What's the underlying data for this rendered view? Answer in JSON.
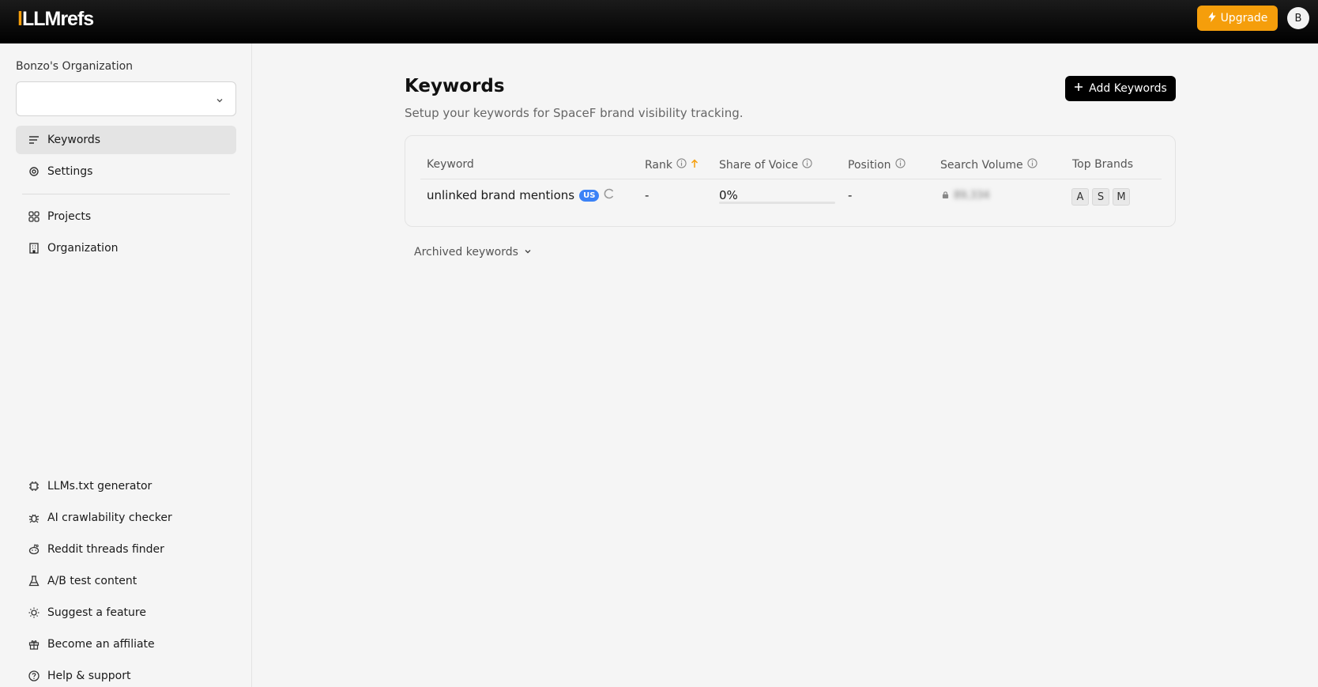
{
  "header": {
    "logo_prefix": "LLM",
    "logo_suffix": "refs",
    "upgrade_label": "Upgrade",
    "avatar_initial": "B",
    "brand_color": "#f59e0b"
  },
  "sidebar": {
    "org_name": "Bonzo's Organization",
    "project_select_value": "",
    "top_items": [
      {
        "label": "Keywords",
        "icon": "lines-icon",
        "active": true
      },
      {
        "label": "Settings",
        "icon": "gear-icon"
      }
    ],
    "mid_items": [
      {
        "label": "Projects",
        "icon": "grid-icon"
      },
      {
        "label": "Organization",
        "icon": "building-icon"
      }
    ],
    "bottom_items": [
      {
        "label": "LLMs.txt generator",
        "icon": "chip-icon"
      },
      {
        "label": "AI crawlability checker",
        "icon": "bug-icon"
      },
      {
        "label": "Reddit threads finder",
        "icon": "reddit-icon"
      },
      {
        "label": "A/B test content",
        "icon": "flask-icon"
      },
      {
        "label": "Suggest a feature",
        "icon": "bulb-icon"
      },
      {
        "label": "Become an affiliate",
        "icon": "gift-icon"
      },
      {
        "label": "Help & support",
        "icon": "help-icon"
      }
    ]
  },
  "main": {
    "title": "Keywords",
    "subtitle": "Setup your keywords for SpaceF brand visibility tracking.",
    "add_button_label": "Add Keywords",
    "archived_label": "Archived keywords",
    "table": {
      "headers": {
        "keyword": "Keyword",
        "rank": "Rank",
        "share_of_voice": "Share of Voice",
        "position": "Position",
        "search_volume": "Search Volume",
        "top_brands": "Top Brands"
      },
      "rows": [
        {
          "keyword": "unlinked brand mentions",
          "country": "US",
          "rank": "-",
          "share_of_voice": "0%",
          "share_of_voice_fraction": 0,
          "position": "-",
          "search_volume": "89,334",
          "top_brands": [
            "A",
            "S",
            "M"
          ]
        }
      ]
    }
  }
}
